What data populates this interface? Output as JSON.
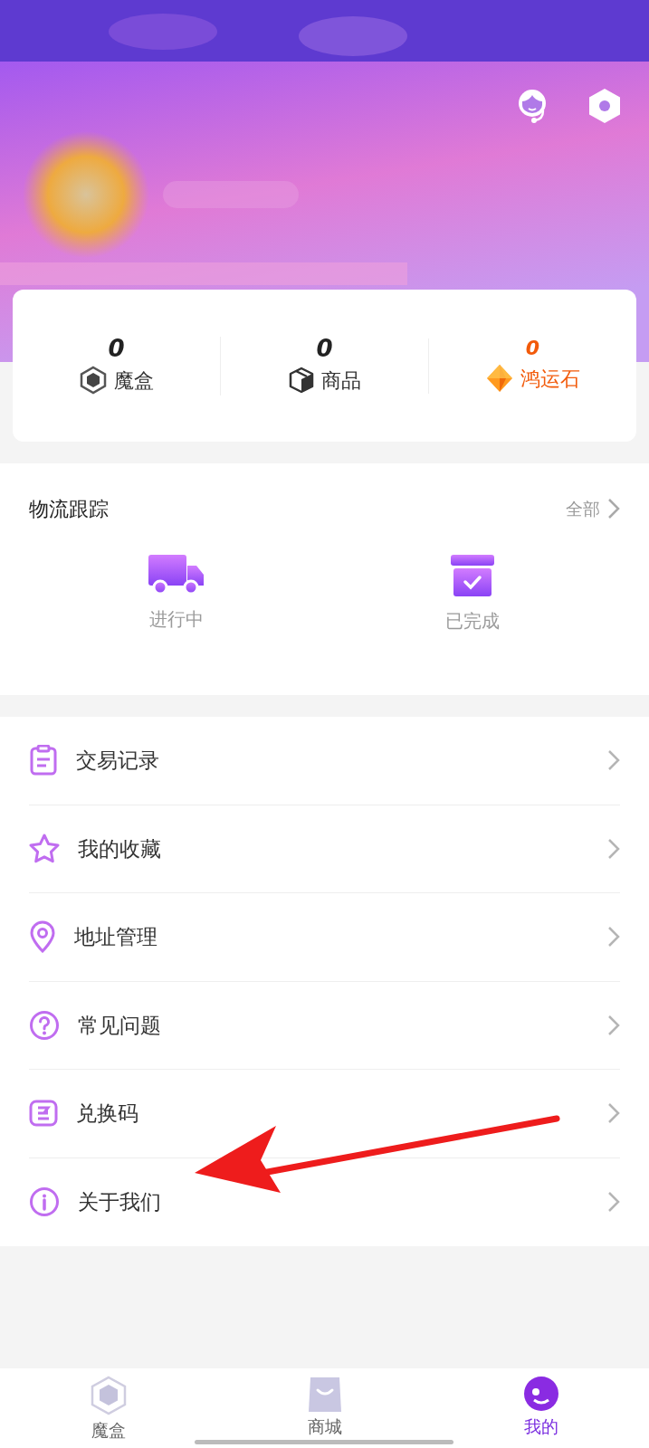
{
  "stats": [
    {
      "value": "0",
      "label": "魔盒",
      "kind": "box",
      "highlight": false
    },
    {
      "value": "0",
      "label": "商品",
      "kind": "package",
      "highlight": false
    },
    {
      "value": "0",
      "label": "鸿运石",
      "kind": "gem",
      "highlight": true
    }
  ],
  "logistics": {
    "title": "物流跟踪",
    "more": "全部",
    "items": [
      {
        "label": "进行中",
        "kind": "truck"
      },
      {
        "label": "已完成",
        "kind": "archive"
      }
    ]
  },
  "menu": [
    {
      "label": "交易记录",
      "kind": "clipboard"
    },
    {
      "label": "我的收藏",
      "kind": "star"
    },
    {
      "label": "地址管理",
      "kind": "pin"
    },
    {
      "label": "常见问题",
      "kind": "question"
    },
    {
      "label": "兑换码",
      "kind": "code"
    },
    {
      "label": "关于我们",
      "kind": "info"
    }
  ],
  "annotation": {
    "kind": "arrow"
  },
  "tabbar": [
    {
      "label": "魔盒",
      "kind": "box",
      "selected": false
    },
    {
      "label": "商城",
      "kind": "bag",
      "selected": false
    },
    {
      "label": "我的",
      "kind": "me",
      "selected": true
    }
  ]
}
